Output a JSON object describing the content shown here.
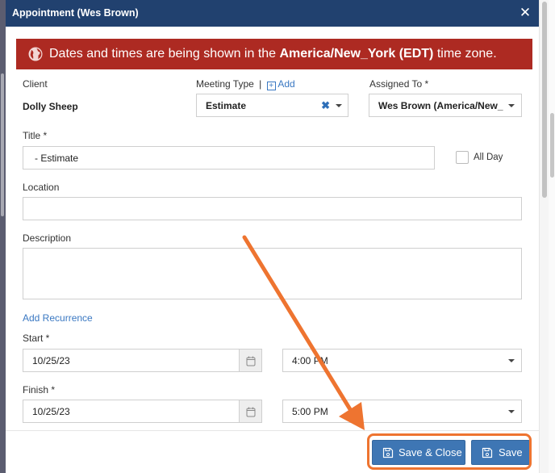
{
  "modal": {
    "title": "Appointment (Wes Brown)",
    "close_icon": "close-icon"
  },
  "timezone_banner": {
    "icon": "globe-icon",
    "prefix": "Dates and times are being shown in the ",
    "zone": "America/New_York (EDT)",
    "suffix": " time zone.",
    "color": "#ad2a22"
  },
  "client": {
    "label": "Client",
    "value": "Dolly Sheep"
  },
  "meeting_type": {
    "label": "Meeting Type",
    "separator": "|",
    "add_label": "Add",
    "value": "Estimate"
  },
  "assigned_to": {
    "label": "Assigned To *",
    "value": "Wes Brown (America/New_"
  },
  "title_field": {
    "label": "Title *",
    "value": "- Estimate"
  },
  "all_day": {
    "label": "All Day",
    "checked": false
  },
  "location": {
    "label": "Location",
    "value": ""
  },
  "description": {
    "label": "Description",
    "value": ""
  },
  "recurrence": {
    "link_label": "Add Recurrence"
  },
  "start": {
    "label": "Start *",
    "date": "10/25/23",
    "time": "4:00 PM"
  },
  "finish": {
    "label": "Finish *",
    "date": "10/25/23",
    "time": "5:00 PM"
  },
  "footer": {
    "save_close_label": "Save & Close",
    "save_label": "Save",
    "button_color": "#3e76b4"
  },
  "annotation": {
    "color": "#ee7430",
    "type": "arrow pointing to highlighted save buttons"
  },
  "colors": {
    "header": "#21416f",
    "link": "#3a78c2"
  }
}
